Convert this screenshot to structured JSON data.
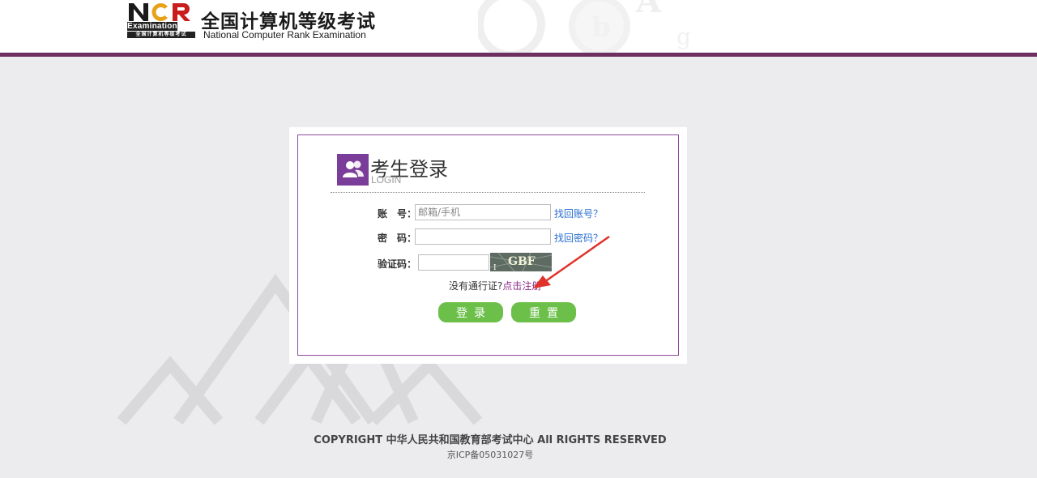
{
  "header": {
    "logo_mark": "NCR",
    "logo_examination": "Examination",
    "logo_tag": "全国计算机等级考试",
    "title": "全国计算机等级考试",
    "subtitle": "National Computer Rank Examination"
  },
  "login": {
    "title": "考生登录",
    "subtitle": "LOGIN",
    "account": {
      "label": "账　号：",
      "placeholder": "邮箱/手机",
      "value": "",
      "recover_link": "找回账号？"
    },
    "password": {
      "label": "密　码：",
      "value": "",
      "recover_link": "找回密码？"
    },
    "captcha": {
      "label": "验证码：",
      "value": "",
      "image_text": "GBF"
    },
    "no_pass_text": "没有通行证?",
    "register_link": "点击注册",
    "login_button": "登录",
    "reset_button": "重置"
  },
  "footer": {
    "copyright": "COPYRIGHT 中华人民共和国教育部考试中心 All RIGHTS RESERVED",
    "icp": "京ICP备05031027号"
  },
  "colors": {
    "accent_purple": "#6d2f60",
    "panel_border": "#8e4a9c",
    "button_green": "#6cc04a",
    "link_blue": "#2a6fd0"
  },
  "icons": [
    "users-icon",
    "arrow-annotation"
  ]
}
